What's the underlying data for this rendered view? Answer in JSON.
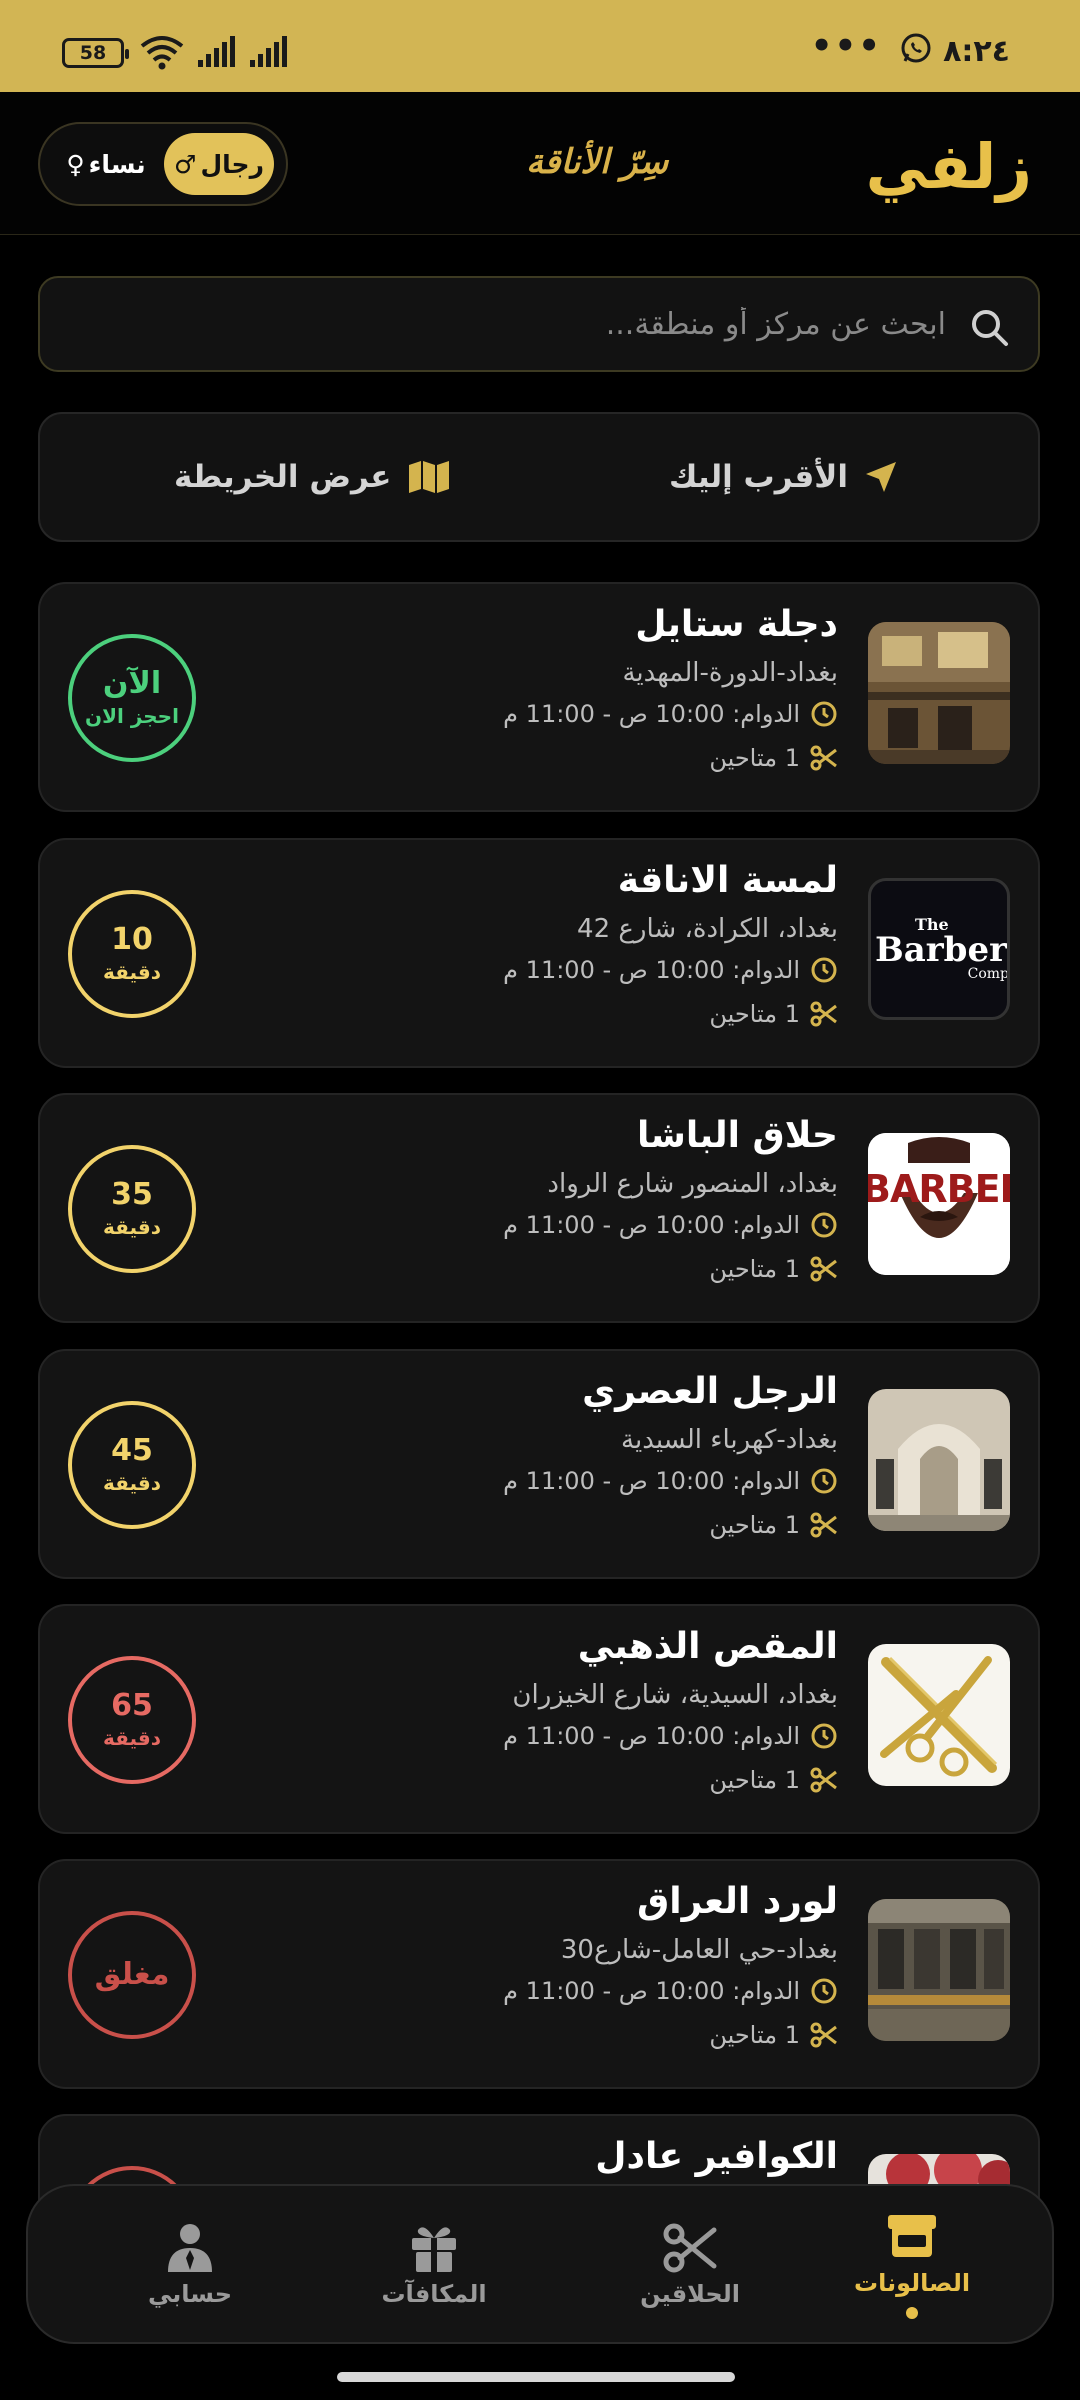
{
  "status_bar": {
    "time": "٨:٢٤",
    "battery": "58",
    "more": "•••"
  },
  "header": {
    "logo": "زلفي",
    "tagline": "سِرّ الأناقة",
    "gender_men": "رجال",
    "gender_women": "نساء",
    "men_symbol": "♂",
    "women_symbol": "♀"
  },
  "search": {
    "placeholder": "ابحث عن مركز أو منطقة..."
  },
  "actions": {
    "nearest": "الأقرب إليك",
    "map": "عرض الخريطة"
  },
  "salons": [
    {
      "name": "دجلة ستايل",
      "address": "بغداد-الدورة-المهدية",
      "hours": "الدوام: 10:00 ص - 11:00 م",
      "barbers": "1 متاحين",
      "wait_main": "الآن",
      "wait_sub": "احجز الان",
      "wait_color": "#4cd07d",
      "thumb": "salon-interior"
    },
    {
      "name": "لمسة الاناقة",
      "address": "بغداد، الكرادة، شارع 42",
      "hours": "الدوام: 10:00 ص - 11:00 م",
      "barbers": "1 متاحين",
      "wait_main": "10",
      "wait_sub": "دقيقة",
      "wait_color": "#f2d36b",
      "thumb": "barber-company-sign",
      "thumb_text_1": "The",
      "thumb_text_2": "Barber",
      "thumb_text_3": "Comp"
    },
    {
      "name": "حلاق الباشا",
      "address": "بغداد، المنصور شارع الرواد",
      "hours": "الدوام: 10:00 ص - 11:00 م",
      "barbers": "1 متاحين",
      "wait_main": "35",
      "wait_sub": "دقيقة",
      "wait_color": "#f2d36b",
      "thumb": "barber-logo",
      "thumb_text_1": "BARBER"
    },
    {
      "name": "الرجل العصري",
      "address": "بغداد-كهرباء السيدية",
      "hours": "الدوام: 10:00 ص - 11:00 م",
      "barbers": "1 متاحين",
      "wait_main": "45",
      "wait_sub": "دقيقة",
      "wait_color": "#f2d36b",
      "thumb": "salon-arches"
    },
    {
      "name": "المقص الذهبي",
      "address": "بغداد، السيدية، شارع الخيزران",
      "hours": "الدوام: 10:00 ص - 11:00 م",
      "barbers": "1 متاحين",
      "wait_main": "65",
      "wait_sub": "دقيقة",
      "wait_color": "#e66a63",
      "thumb": "gold-scissors"
    },
    {
      "name": "لورد العراق",
      "address": "بغداد-حي العامل-شارع30",
      "hours": "الدوام: 10:00 ص - 11:00 م",
      "barbers": "1 متاحين",
      "wait_main": "مغلق",
      "wait_sub": "",
      "wait_color": "#c9504a",
      "thumb": "salon-shop"
    },
    {
      "name": "الكوافير عادل",
      "address": "",
      "hours": "",
      "barbers": "",
      "wait_main": "",
      "wait_sub": "",
      "wait_color": "#c9504a",
      "thumb": "flowers"
    }
  ],
  "nav": {
    "salons": "الصالونات",
    "barbers": "الحلاقين",
    "rewards": "المكافآت",
    "account": "حسابي"
  },
  "colors": {
    "accent": "#e8c04a",
    "statusbar": "#d2b554",
    "background": "#000000",
    "card": "#141414"
  }
}
